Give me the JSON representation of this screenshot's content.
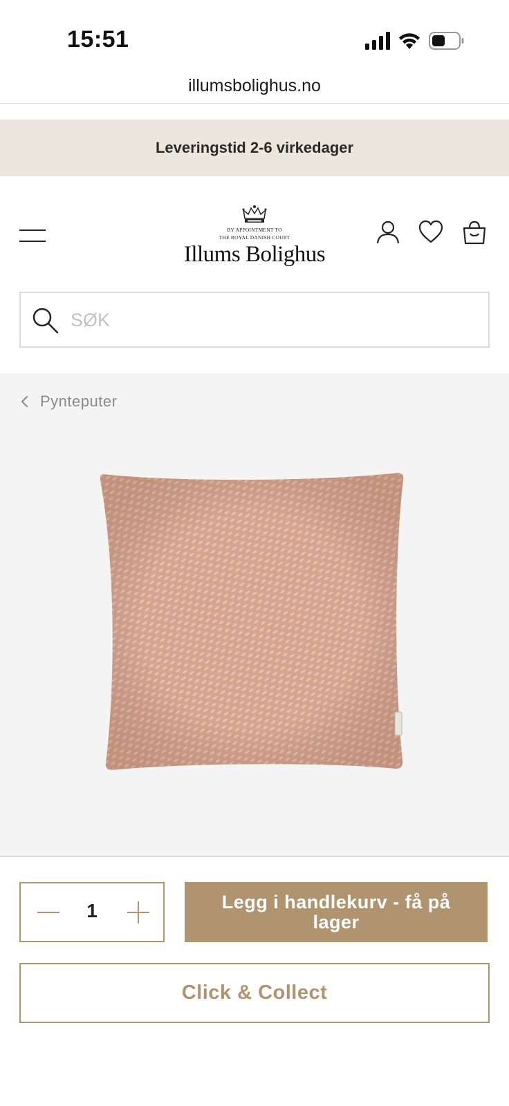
{
  "status_bar": {
    "time": "15:51"
  },
  "browser": {
    "url": "illumsbolighus.no"
  },
  "banner": {
    "text": "Leveringstid 2-6 virkedager"
  },
  "header": {
    "logo": {
      "appointment_line1": "BY APPOINTMENT TO",
      "appointment_line2": "THE ROYAL DANISH COURT",
      "name": "Illums Bolighus"
    },
    "icons": [
      "menu-icon",
      "user-icon",
      "heart-icon",
      "shopping-bag-icon"
    ]
  },
  "search": {
    "placeholder": "SØK",
    "value": ""
  },
  "breadcrumb": {
    "label": "Pynteputer"
  },
  "product": {
    "image_icon": "pillow-image",
    "pillow_color": "#d9a892"
  },
  "purchase": {
    "quantity": "1",
    "add_to_cart_label": "Legg i handlekurv - få på lager",
    "click_collect_label": "Click & Collect"
  },
  "colors": {
    "accent": "#b09470",
    "banner_bg": "#ede6dd",
    "product_bg": "#f4f4f4"
  }
}
